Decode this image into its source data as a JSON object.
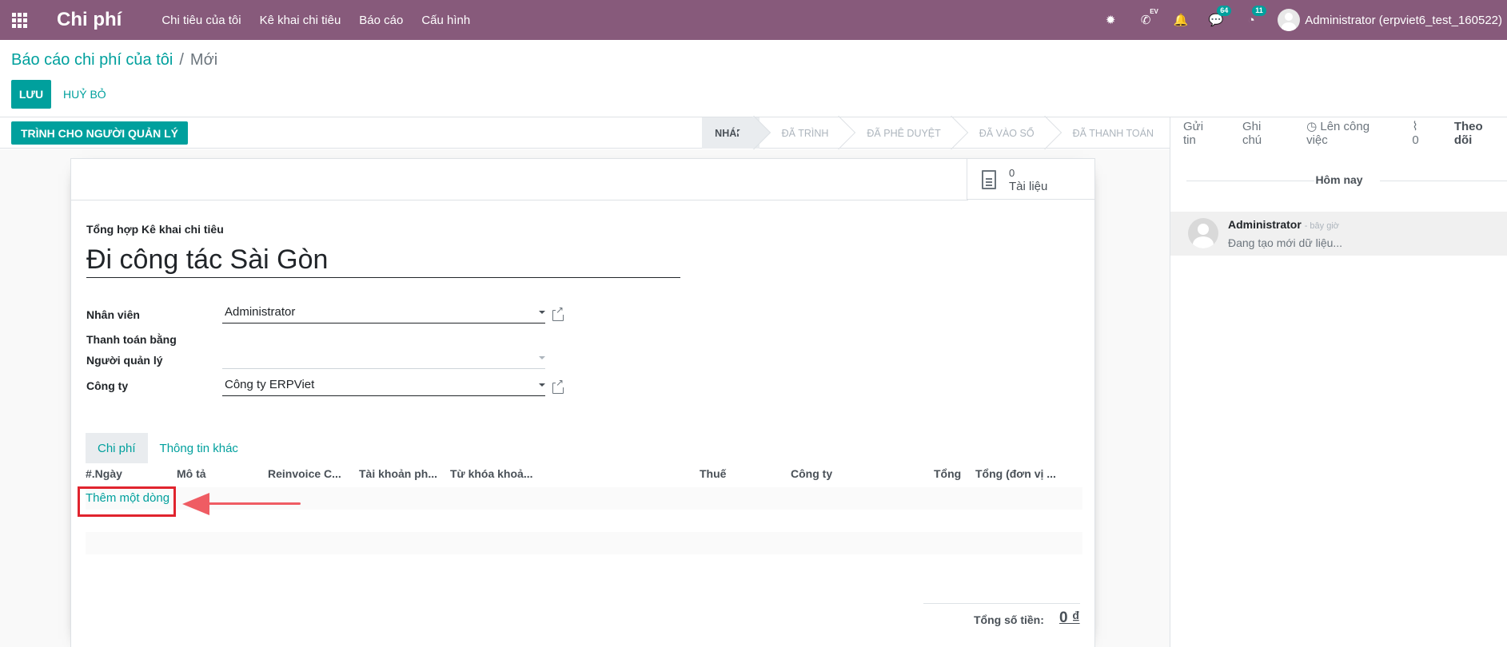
{
  "navbar": {
    "app_title": "Chi phí",
    "menu": [
      "Chi tiêu của tôi",
      "Kê khai chi tiêu",
      "Báo cáo",
      "Cấu hình"
    ],
    "call_badge": "EV",
    "messages_badge": "64",
    "activities_badge": "11",
    "user": "Administrator (erpviet6_test_160522)"
  },
  "breadcrumb": {
    "parent": "Báo cáo chi phí của tôi",
    "separator": "/",
    "current": "Mới"
  },
  "actions": {
    "save": "LƯU",
    "discard": "HUỶ BỎ"
  },
  "statusbar": {
    "submit_button": "TRÌNH CHO NGƯỜI QUẢN LÝ",
    "stages": [
      "NHÁP",
      "ĐÃ TRÌNH",
      "ĐÃ PHÊ DUYỆT",
      "ĐÃ VÀO SỔ",
      "ĐÃ THANH TOÁN"
    ],
    "active_stage": "NHÁP"
  },
  "chatter": {
    "send_message": "Gửi tin",
    "log_note": "Ghi chú",
    "schedule_activity": "Lên công việc",
    "attachments_count": "0",
    "follow": "Theo dõi",
    "date_separator": "Hôm nay",
    "message": {
      "author": "Administrator",
      "time": "- bây giờ",
      "body": "Đang tạo mới dữ liệu..."
    }
  },
  "form": {
    "documents_count": "0",
    "documents_label": "Tài liệu",
    "summary_label": "Tổng hợp Kê khai chi tiêu",
    "summary_value": "Đi công tác Sài Gòn",
    "employee_label": "Nhân viên",
    "employee_value": "Administrator",
    "payment_label": "Thanh toán bằng",
    "manager_label": "Người quản lý",
    "manager_value": "",
    "company_label": "Công ty",
    "company_value": "Công ty ERPViet",
    "tabs": [
      "Chi phí",
      "Thông tin khác"
    ],
    "table_headers": [
      "#.Ngày",
      "Mô tả",
      "Reinvoice C...",
      "Tài khoản ph...",
      "Từ khóa khoả...",
      "Thuế",
      "Công ty",
      "Tổng",
      "Tổng (đơn vị ..."
    ],
    "add_line": "Thêm một dòng",
    "total_label": "Tổng số tiền:",
    "total_value": "0 ₫"
  },
  "colors": {
    "brand": "#875a7b",
    "accent": "#00a09d",
    "highlight": "#e0242e"
  }
}
